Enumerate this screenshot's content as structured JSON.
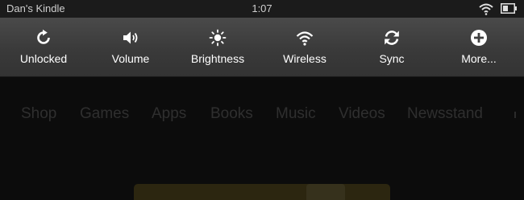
{
  "status_bar": {
    "device_name": "Dan's Kindle",
    "time": "1:07",
    "wifi_icon": "wifi-icon",
    "battery_icon": "battery-icon"
  },
  "quick_settings": [
    {
      "label": "Unlocked",
      "icon": "rotation-unlocked-icon"
    },
    {
      "label": "Volume",
      "icon": "volume-icon"
    },
    {
      "label": "Brightness",
      "icon": "brightness-icon"
    },
    {
      "label": "Wireless",
      "icon": "wireless-icon"
    },
    {
      "label": "Sync",
      "icon": "sync-icon"
    },
    {
      "label": "More...",
      "icon": "plus-circle-icon"
    }
  ],
  "nav": [
    {
      "label": "Shop"
    },
    {
      "label": "Games"
    },
    {
      "label": "Apps"
    },
    {
      "label": "Books"
    },
    {
      "label": "Music"
    },
    {
      "label": "Videos"
    },
    {
      "label": "Newsstand"
    }
  ],
  "colors": {
    "status_bar_bg": "#1b1b1b",
    "quick_settings_bg": "#404040",
    "background": "#0c0c0c",
    "nav_text": "#2f2f2f",
    "carousel_accent": "#2c2610"
  }
}
